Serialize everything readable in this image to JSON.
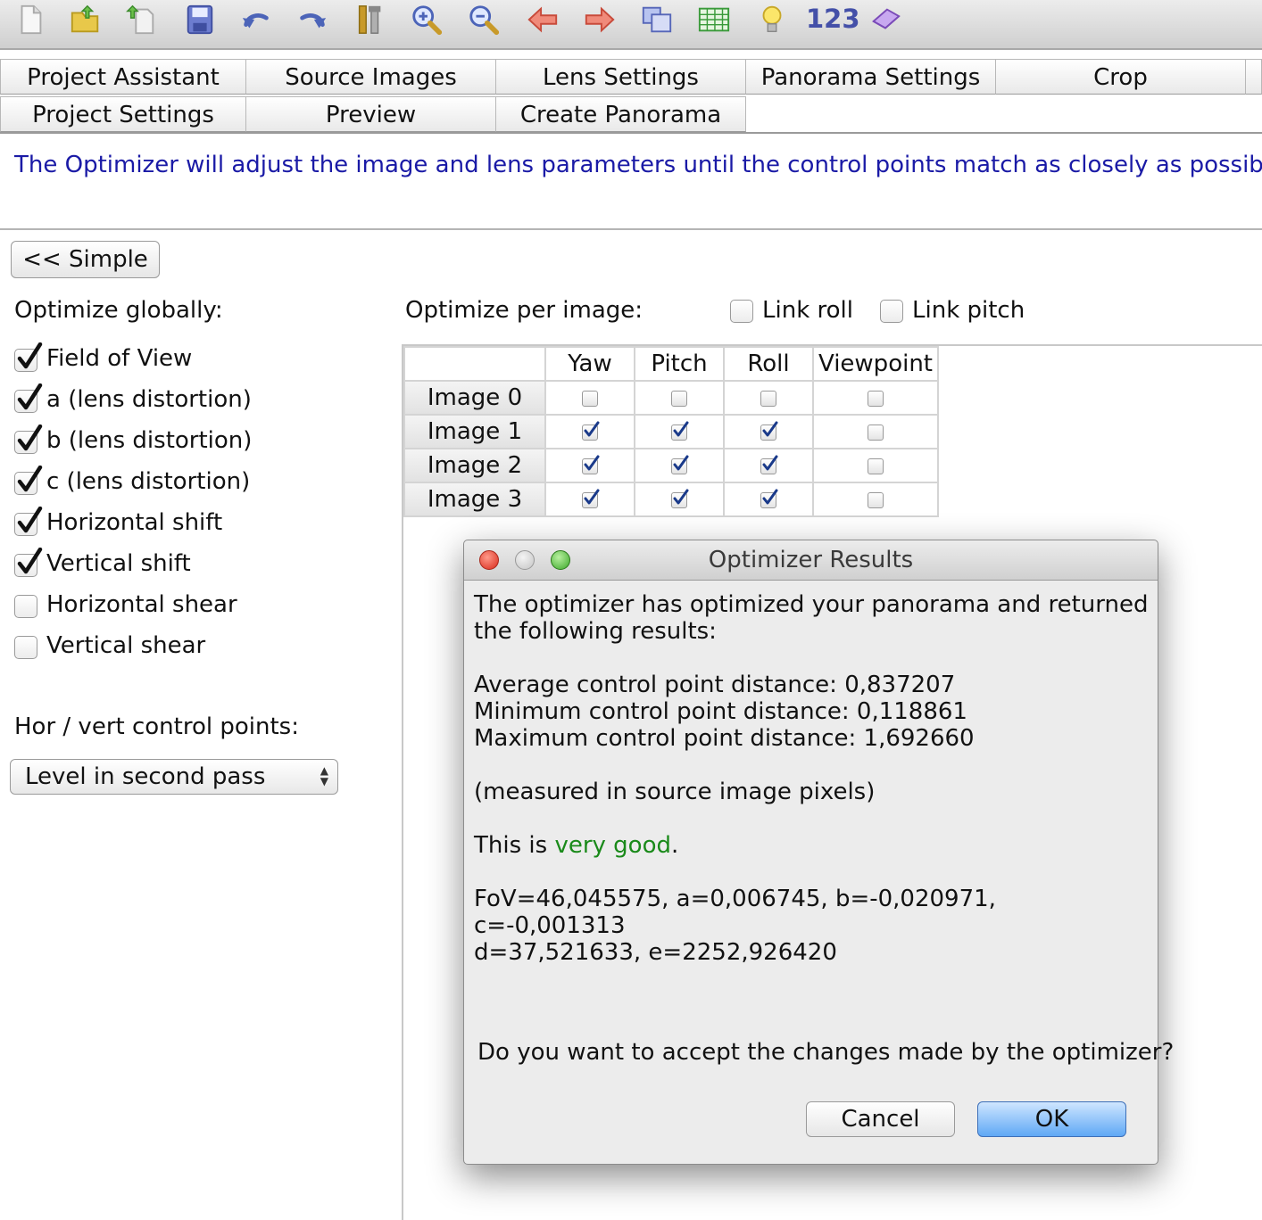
{
  "toolbar": {
    "icons": [
      "new-file-icon",
      "open-file-icon",
      "open-recent-icon",
      "save-icon",
      "undo-icon",
      "redo-icon",
      "tools-icon",
      "zoom-in-icon",
      "zoom-out-icon",
      "back-arrow-icon",
      "forward-arrow-icon",
      "images-icon",
      "table-icon",
      "lightbulb-icon",
      "lasso-icon"
    ],
    "number_label": "123"
  },
  "tabs": {
    "row1": [
      "Project Assistant",
      "Source Images",
      "Lens Settings",
      "Panorama Settings",
      "Crop"
    ],
    "row2": [
      "Project Settings",
      "Preview",
      "Create Panorama"
    ]
  },
  "info_text": "The Optimizer will adjust the image and lens parameters until the control points match as closely as possible.",
  "simple_button": "<< Simple",
  "optimize_globally": {
    "label": "Optimize globally:",
    "options": [
      {
        "label": "Field of View",
        "checked": true
      },
      {
        "label": "a (lens distortion)",
        "checked": true
      },
      {
        "label": "b (lens distortion)",
        "checked": true
      },
      {
        "label": "c (lens distortion)",
        "checked": true
      },
      {
        "label": "Horizontal shift",
        "checked": true
      },
      {
        "label": "Vertical shift",
        "checked": true
      },
      {
        "label": "Horizontal shear",
        "checked": false
      },
      {
        "label": "Vertical shear",
        "checked": false
      }
    ]
  },
  "per_image": {
    "label": "Optimize per image:",
    "link_roll": "Link roll",
    "link_pitch": "Link pitch",
    "columns": [
      "Yaw",
      "Pitch",
      "Roll",
      "Viewpoint"
    ],
    "rows": [
      {
        "name": "Image 0",
        "values": [
          false,
          false,
          false,
          false
        ]
      },
      {
        "name": "Image 1",
        "values": [
          true,
          true,
          true,
          false
        ]
      },
      {
        "name": "Image 2",
        "values": [
          true,
          true,
          true,
          false
        ]
      },
      {
        "name": "Image 3",
        "values": [
          true,
          true,
          true,
          false
        ]
      }
    ]
  },
  "control_points": {
    "label": "Hor / vert control points:",
    "selected": "Level in second pass"
  },
  "dialog": {
    "title": "Optimizer Results",
    "intro_line1": "The optimizer has optimized your panorama and returned",
    "intro_line2": "the following results:",
    "avg": "Average control point distance: 0,837207",
    "min": "Minimum control point distance: 0,118861",
    "max": "Maximum control point distance: 1,692660",
    "measured": "(measured in source image pixels)",
    "quality_prefix": "This is ",
    "quality_value": "very good",
    "quality_suffix": ".",
    "params_line1": "FoV=46,045575, a=0,006745, b=-0,020971,",
    "params_line2": "c=-0,001313",
    "params_line3": "d=37,521633, e=2252,926420",
    "question": "Do you want to accept the changes made by the optimizer?",
    "cancel": "Cancel",
    "ok": "OK"
  }
}
